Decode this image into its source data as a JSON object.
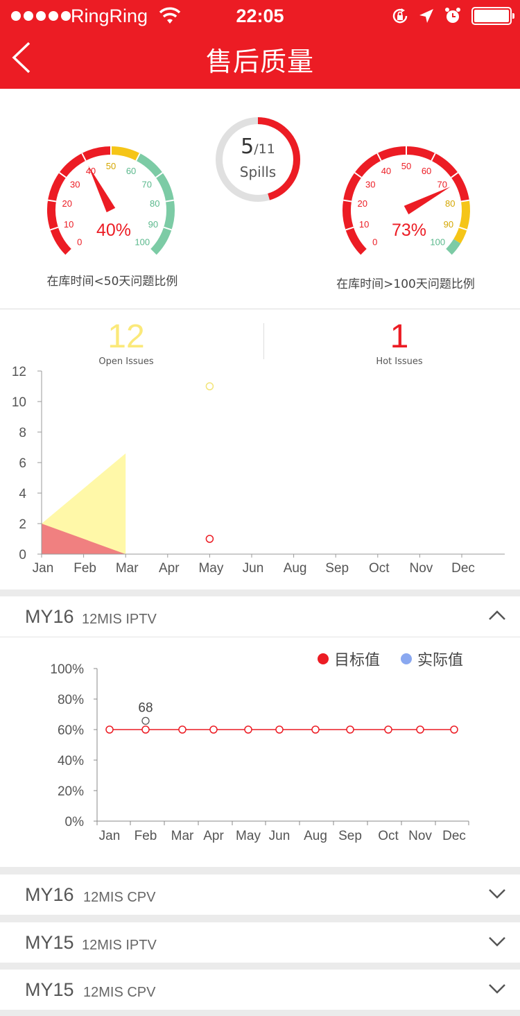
{
  "status_bar": {
    "carrier": "RingRing",
    "time": "22:05"
  },
  "nav": {
    "title": "售后质量"
  },
  "gauge_left": {
    "value_text": "40%",
    "value": 40,
    "caption": "在库时间<50天问题比例",
    "ticks": [
      "0",
      "10",
      "20",
      "30",
      "40",
      "50",
      "60",
      "70",
      "80",
      "90",
      "100"
    ]
  },
  "gauge_right": {
    "value_text": "73%",
    "value": 73,
    "caption": "在库时间>100天问题比例",
    "ticks": [
      "0",
      "10",
      "20",
      "30",
      "40",
      "50",
      "60",
      "70",
      "80",
      "90",
      "100"
    ]
  },
  "spills": {
    "count": "5",
    "total": "/11",
    "label": "Spills",
    "fraction": 0.4545
  },
  "kpis": {
    "open": {
      "value": "12",
      "label": "Open Issues"
    },
    "hot": {
      "value": "1",
      "label": "Hot Issues"
    }
  },
  "colors": {
    "red": "#ec1c24",
    "yellow": "#f5c518",
    "green": "#7ccba5",
    "pale_yellow": "#fff8a8",
    "pink": "#f08080",
    "blue": "#8aa8f0"
  },
  "chart_data": [
    {
      "type": "area",
      "categories": [
        "Jan",
        "Feb",
        "Mar",
        "Apr",
        "May",
        "Jun",
        "Aug",
        "Sep",
        "Oct",
        "Nov",
        "Dec"
      ],
      "ylim": [
        0,
        12
      ],
      "yticks": [
        "0",
        "2",
        "4",
        "6",
        "8",
        "10",
        "12"
      ],
      "series": [
        {
          "values": [
            0,
            3.3,
            6.6,
            null,
            11,
            null,
            null,
            null,
            null,
            null,
            null
          ]
        },
        {
          "values": [
            2,
            1,
            0,
            null,
            1,
            null,
            null,
            null,
            null,
            null,
            null
          ]
        }
      ]
    },
    {
      "type": "line",
      "categories": [
        "Jan",
        "Feb",
        "Mar",
        "Apr",
        "May",
        "Jun",
        "Aug",
        "Sep",
        "Oct",
        "Nov",
        "Dec"
      ],
      "ylim": [
        0,
        100
      ],
      "yticks": [
        "0%",
        "20%",
        "40%",
        "60%",
        "80%",
        "100%"
      ],
      "series": [
        {
          "name": "目标值",
          "values": [
            60,
            60,
            60,
            60,
            60,
            60,
            60,
            60,
            60,
            60,
            60
          ]
        },
        {
          "name": "实际值",
          "values": [
            null,
            68,
            null,
            null,
            null,
            null,
            null,
            null,
            null,
            null,
            null
          ]
        }
      ],
      "annotations": [
        {
          "x": "Feb",
          "text": "68"
        }
      ]
    }
  ],
  "sections": [
    {
      "model": "MY16",
      "sub": "12MIS IPTV",
      "expanded": true
    },
    {
      "model": "MY16",
      "sub": "12MIS CPV",
      "expanded": false
    },
    {
      "model": "MY15",
      "sub": "12MIS IPTV",
      "expanded": false
    },
    {
      "model": "MY15",
      "sub": "12MIS CPV",
      "expanded": false
    }
  ]
}
